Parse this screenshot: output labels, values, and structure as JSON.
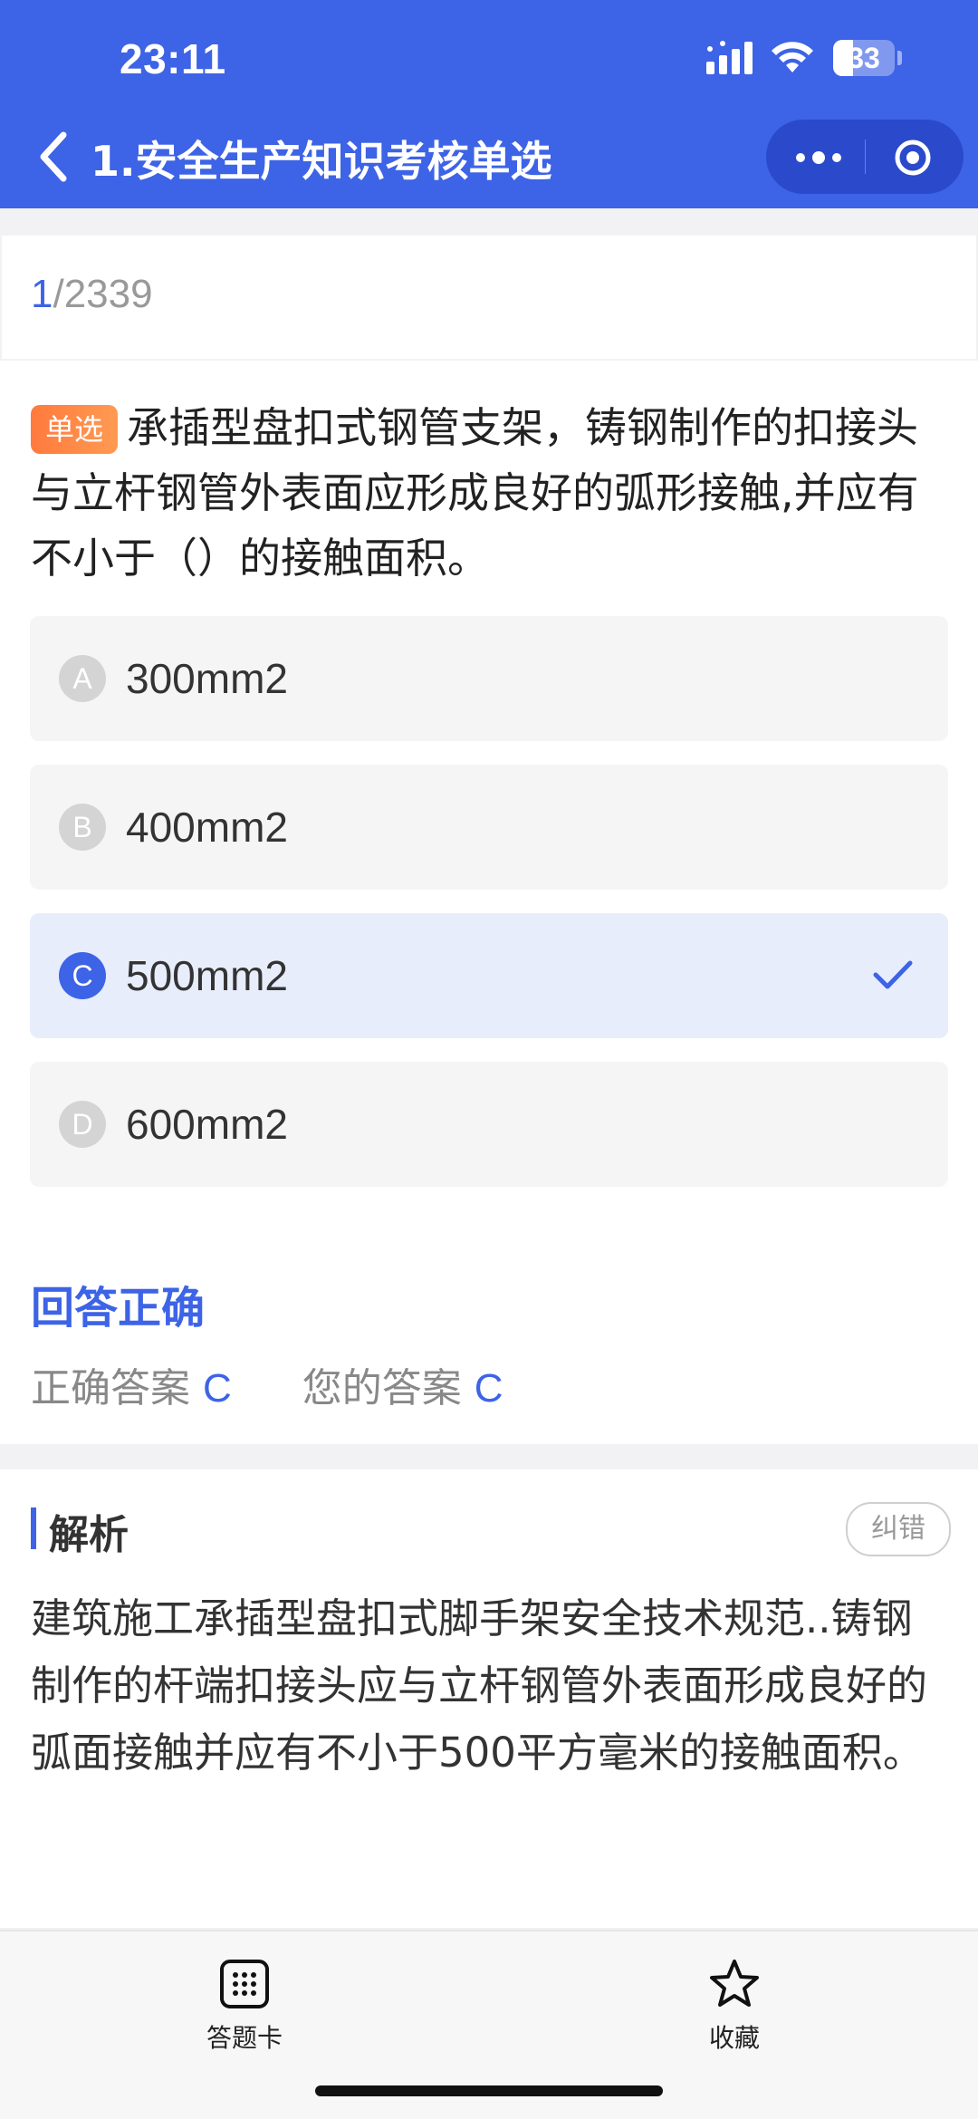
{
  "status": {
    "time": "23:11",
    "battery": "33",
    "battery_level": 0.33
  },
  "nav": {
    "title": "1.安全生产知识考核单选",
    "back_icon": "chevron-left-icon",
    "more_icon": "more-dots-icon",
    "close_icon": "target-circle-icon"
  },
  "progress": {
    "current": "1",
    "total": "/2339"
  },
  "question": {
    "type_badge": "单选",
    "text": "承插型盘扣式钢管支架，铸钢制作的扣接头与立杆钢管外表面应形成良好的弧形接触,并应有不小于（）的接触面积。",
    "options": [
      {
        "letter": "A",
        "text": "300mm2",
        "selected": false
      },
      {
        "letter": "B",
        "text": "400mm2",
        "selected": false
      },
      {
        "letter": "C",
        "text": "500mm2",
        "selected": true
      },
      {
        "letter": "D",
        "text": "600mm2",
        "selected": false
      }
    ]
  },
  "result": {
    "title": "回答正确",
    "correct_label": "正确答案",
    "correct_value": "C",
    "yours_label": "您的答案",
    "yours_value": "C"
  },
  "analysis": {
    "title": "解析",
    "report_label": "纠错",
    "text": "建筑施工承插型盘扣式脚手架安全技术规范..铸钢制作的杆端扣接头应与立杆钢管外表面形成良好的弧面接触并应有不小于500平方毫米的接触面积。"
  },
  "tabbar": {
    "card_label": "答题卡",
    "card_icon": "grid-keypad-icon",
    "fav_label": "收藏",
    "fav_icon": "star-icon"
  },
  "colors": {
    "primary": "#3d63e6",
    "badge": "#ff7a3d"
  }
}
